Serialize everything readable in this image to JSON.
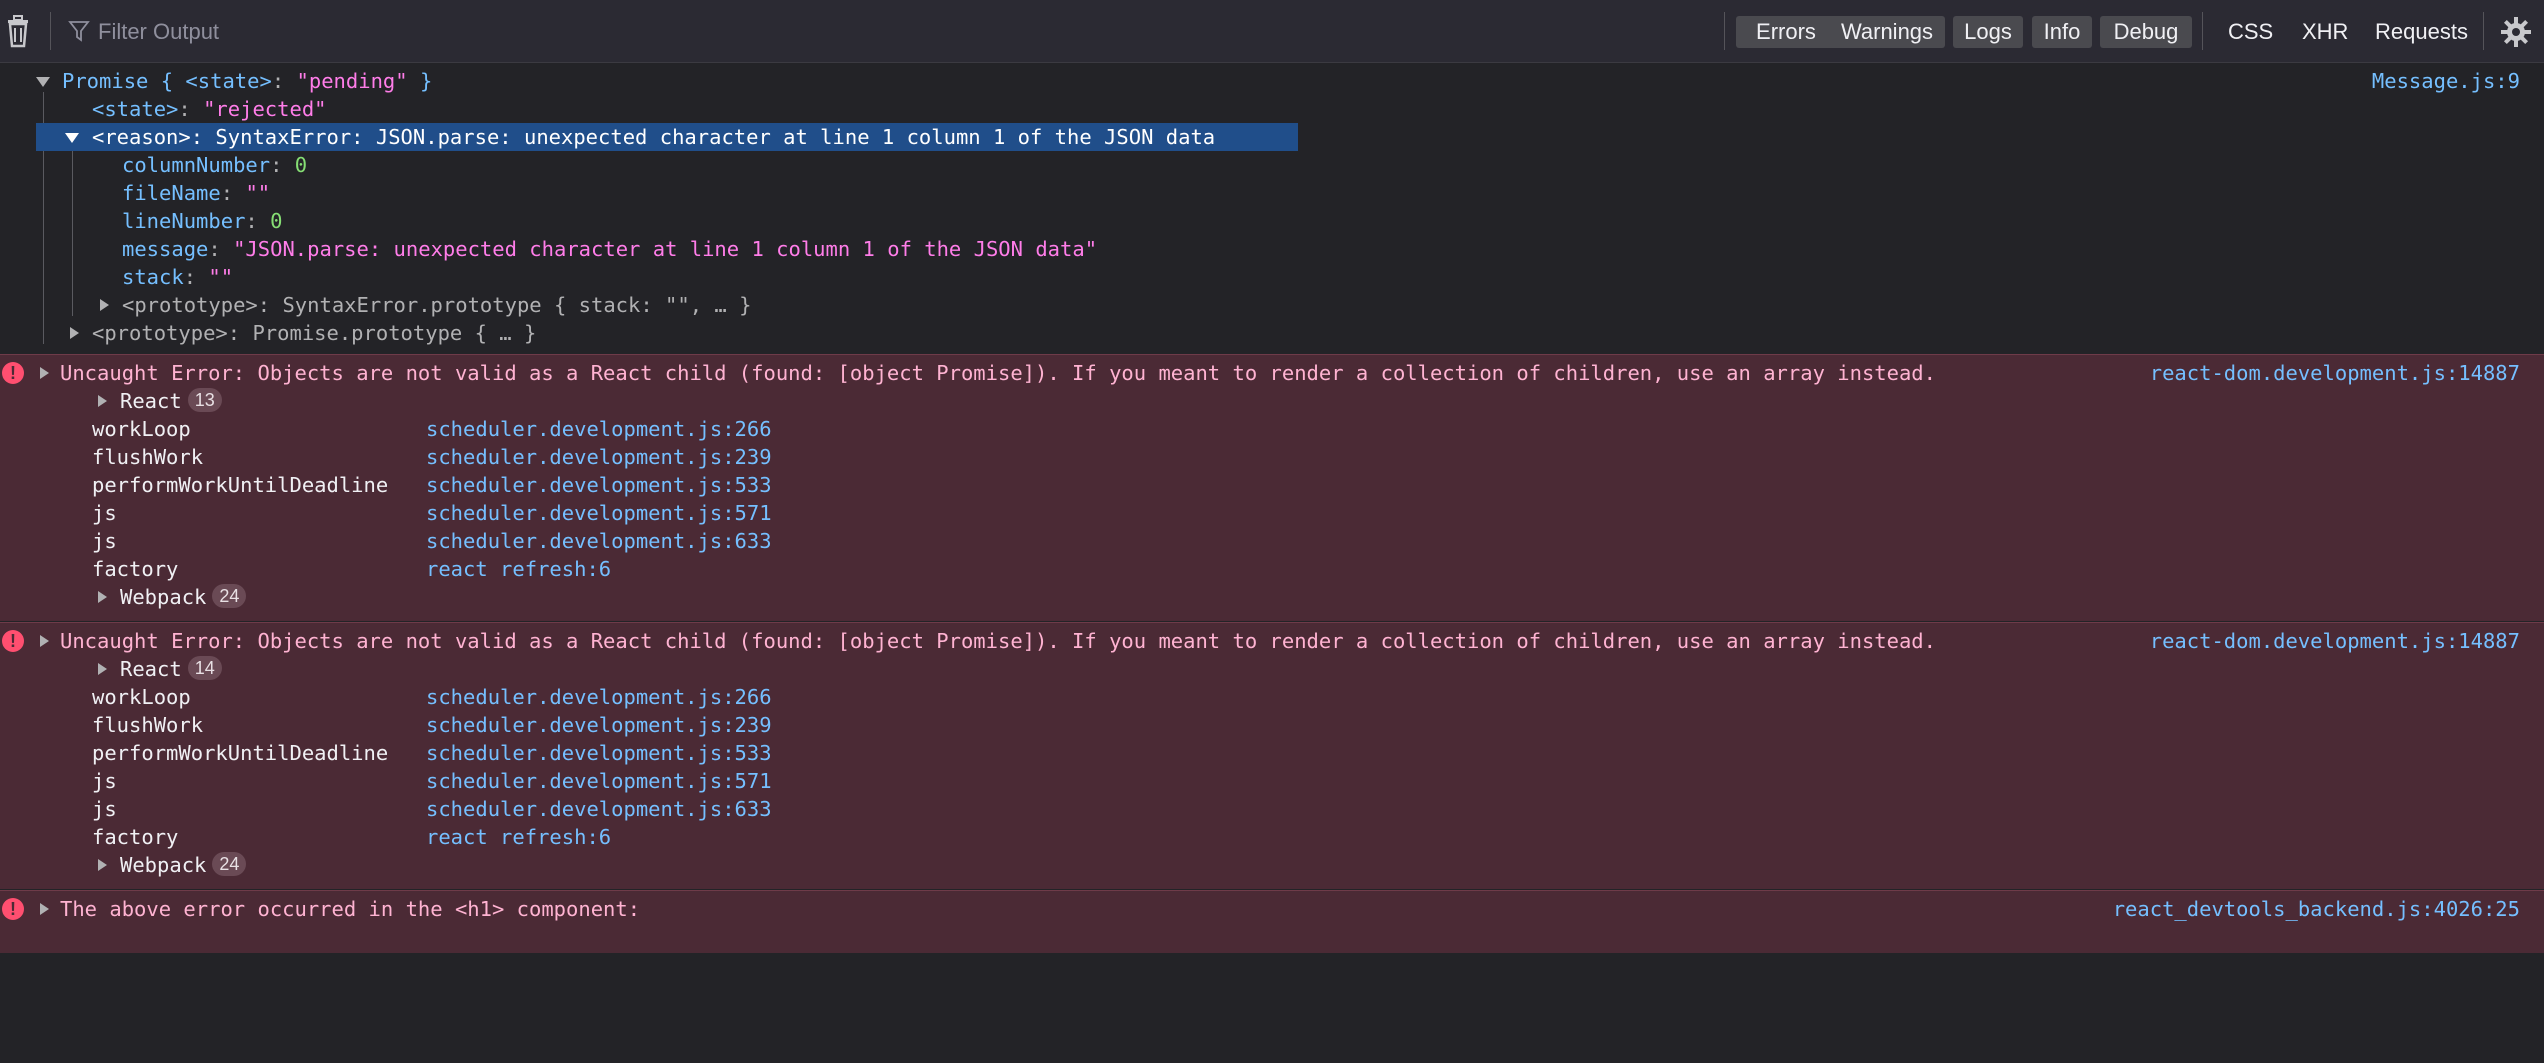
{
  "toolbar": {
    "filter_placeholder": "Filter Output",
    "levels": [
      "Errors",
      "Warnings",
      "Logs",
      "Info",
      "Debug"
    ],
    "types": [
      "CSS",
      "XHR",
      "Requests"
    ]
  },
  "promise_log": {
    "header": {
      "prefix": "Promise { ",
      "state_key": "<state>",
      "colon": ": ",
      "state_val": "\"pending\"",
      "suffix": " }"
    },
    "source": "Message.js:9",
    "state_row": {
      "key": "<state>",
      "value": "\"rejected\""
    },
    "reason_row": {
      "text": "<reason>: SyntaxError: JSON.parse: unexpected character at line 1 column 1 of the JSON data"
    },
    "props": [
      {
        "key": "columnNumber",
        "value": "0",
        "kind": "num"
      },
      {
        "key": "fileName",
        "value": "\"\"",
        "kind": "str"
      },
      {
        "key": "lineNumber",
        "value": "0",
        "kind": "num"
      },
      {
        "key": "message",
        "value": "\"JSON.parse: unexpected character at line 1 column 1 of the JSON data\"",
        "kind": "str"
      },
      {
        "key": "stack",
        "value": "\"\"",
        "kind": "str"
      }
    ],
    "proto_reason": "<prototype>: SyntaxError.prototype { stack: \"\", … }",
    "proto_promise": "<prototype>: Promise.prototype { … }"
  },
  "errors": [
    {
      "message": "Uncaught Error: Objects are not valid as a React child (found: [object Promise]). If you meant to render a collection of children, use an array instead.",
      "source": "react-dom.development.js:14887",
      "group1": {
        "name": "React",
        "count": "13"
      },
      "frames": [
        {
          "fn": "workLoop",
          "loc": "scheduler.development.js:266"
        },
        {
          "fn": "flushWork",
          "loc": "scheduler.development.js:239"
        },
        {
          "fn": "performWorkUntilDeadline",
          "loc": "scheduler.development.js:533"
        },
        {
          "fn": "js",
          "loc": "scheduler.development.js:571"
        },
        {
          "fn": "js",
          "loc": "scheduler.development.js:633"
        },
        {
          "fn": "factory",
          "loc": "react refresh:6"
        }
      ],
      "group2": {
        "name": "Webpack",
        "count": "24"
      }
    },
    {
      "message": "Uncaught Error: Objects are not valid as a React child (found: [object Promise]). If you meant to render a collection of children, use an array instead.",
      "source": "react-dom.development.js:14887",
      "group1": {
        "name": "React",
        "count": "14"
      },
      "frames": [
        {
          "fn": "workLoop",
          "loc": "scheduler.development.js:266"
        },
        {
          "fn": "flushWork",
          "loc": "scheduler.development.js:239"
        },
        {
          "fn": "performWorkUntilDeadline",
          "loc": "scheduler.development.js:533"
        },
        {
          "fn": "js",
          "loc": "scheduler.development.js:571"
        },
        {
          "fn": "js",
          "loc": "scheduler.development.js:633"
        },
        {
          "fn": "factory",
          "loc": "react refresh:6"
        }
      ],
      "group2": {
        "name": "Webpack",
        "count": "24"
      }
    }
  ],
  "last_error": {
    "message": "The above error occurred in the <h1> component:",
    "source": "react_devtools_backend.js:4026:25"
  },
  "colors": {
    "error_bg": "#4b2a35",
    "selection": "#204e8a",
    "link": "#75bfff",
    "string": "#ff7de9",
    "number": "#86de74"
  },
  "icons": [
    "trash-icon",
    "filter-icon",
    "gear-icon",
    "error-icon",
    "expand-arrow-icon",
    "collapse-arrow-icon"
  ]
}
